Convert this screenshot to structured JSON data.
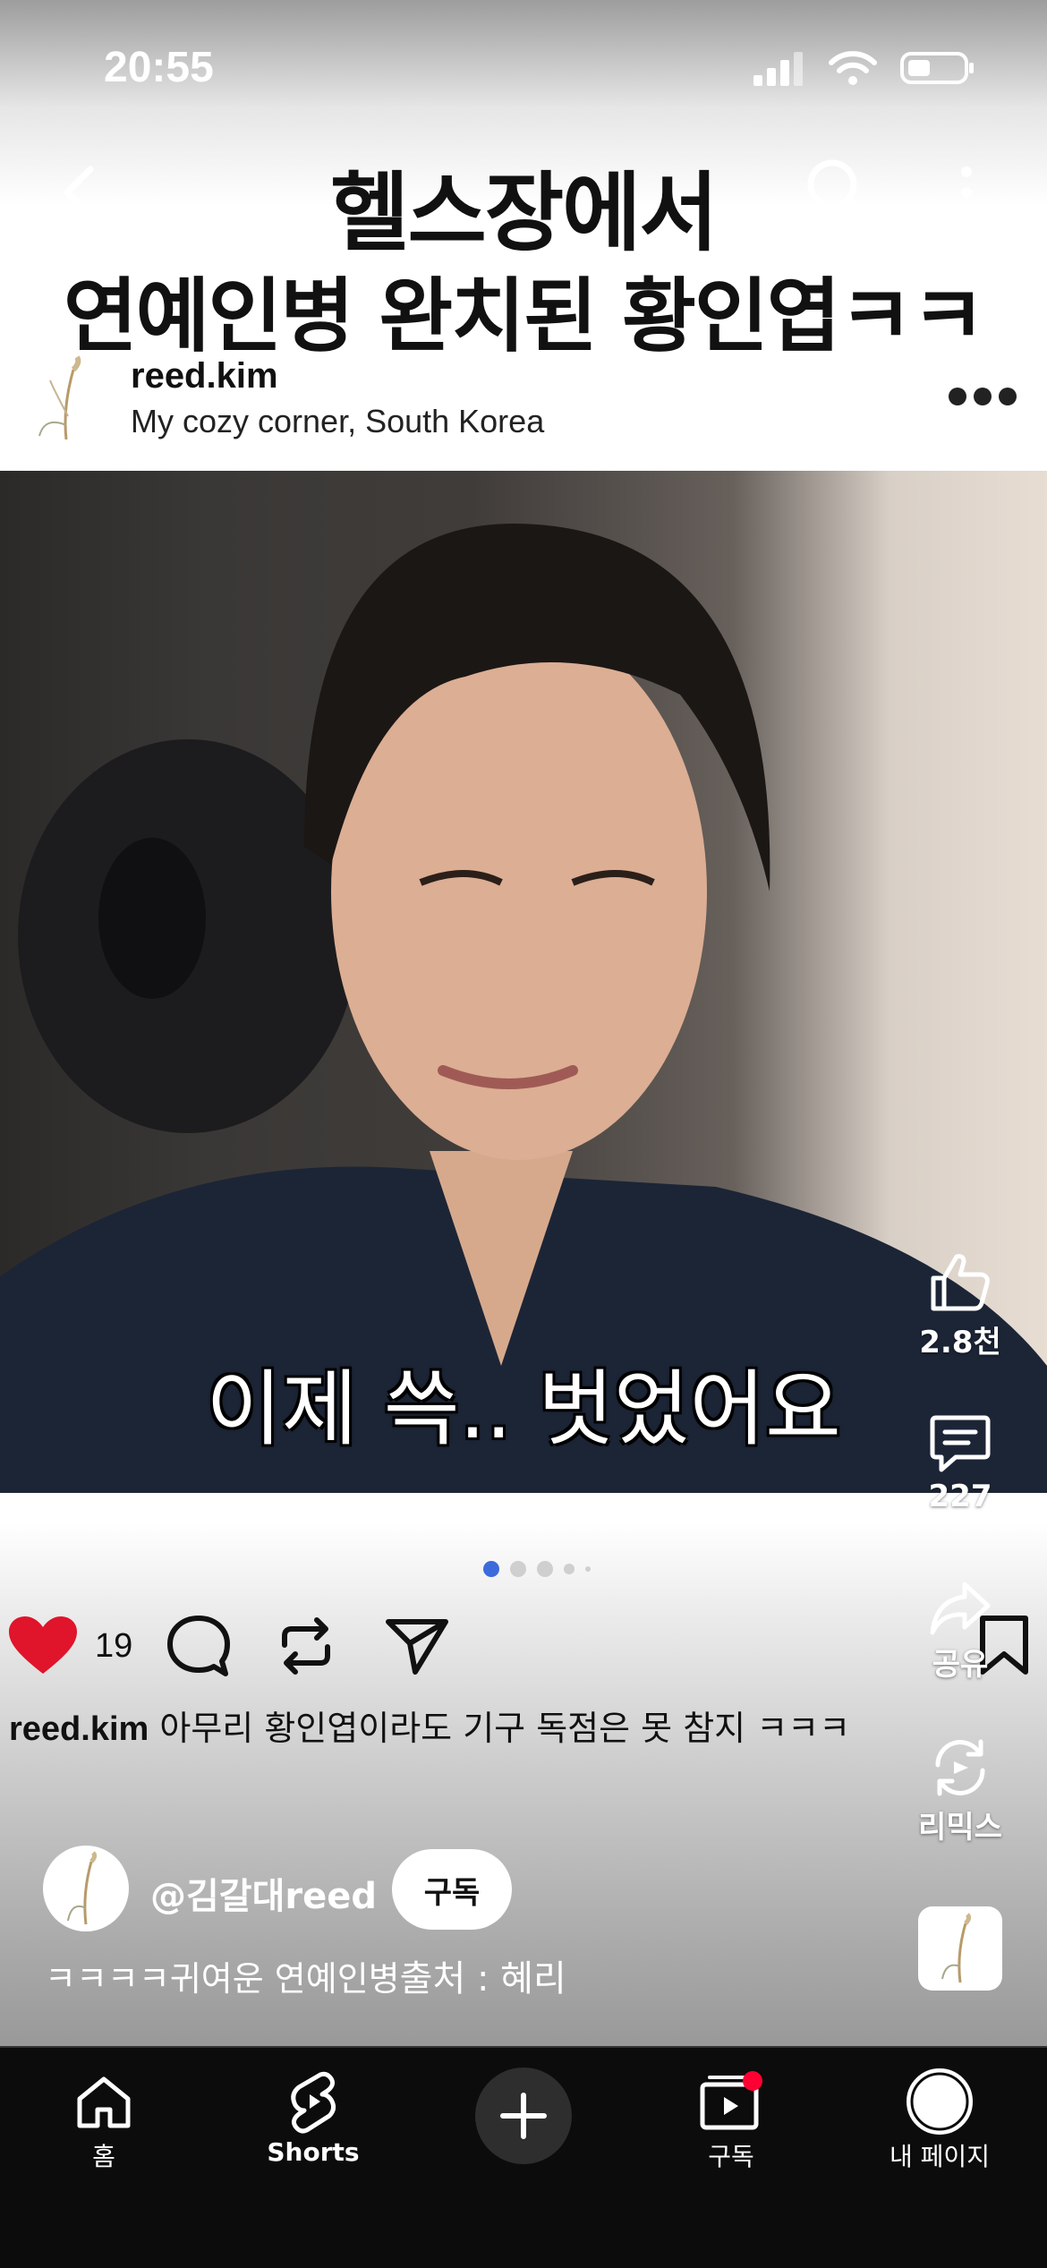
{
  "status_bar": {
    "time": "20:55"
  },
  "title": {
    "line1": "헬스장에서",
    "line2": "연예인병 완치된 황인엽ㅋㅋ"
  },
  "post": {
    "username": "reed.kim",
    "location": "My cozy corner, South Korea",
    "subtitle": "이제 쓱.. 벗었어요",
    "like_count": "19",
    "caption_user": "reed.kim",
    "caption_text": " 아무리 황인엽이라도 기구 독점은 못 참지 ㅋㅋㅋ"
  },
  "rail": {
    "like_label": "2.8천",
    "comment_label": "227",
    "share_label": "공유",
    "remix_label": "리믹스"
  },
  "channel": {
    "name": "@김갈대reed",
    "subscribe_label": "구독",
    "desc": "ㅋㅋㅋㅋ귀여운 연예인병",
    "source": "출처 : 혜리"
  },
  "bottom_nav": {
    "home": "홈",
    "shorts": "Shorts",
    "subscriptions": "구독",
    "me": "내 페이지"
  },
  "colors": {
    "like_red": "#e0142a",
    "pager_active": "#3d6bdc",
    "notif_red": "#ff0033"
  }
}
